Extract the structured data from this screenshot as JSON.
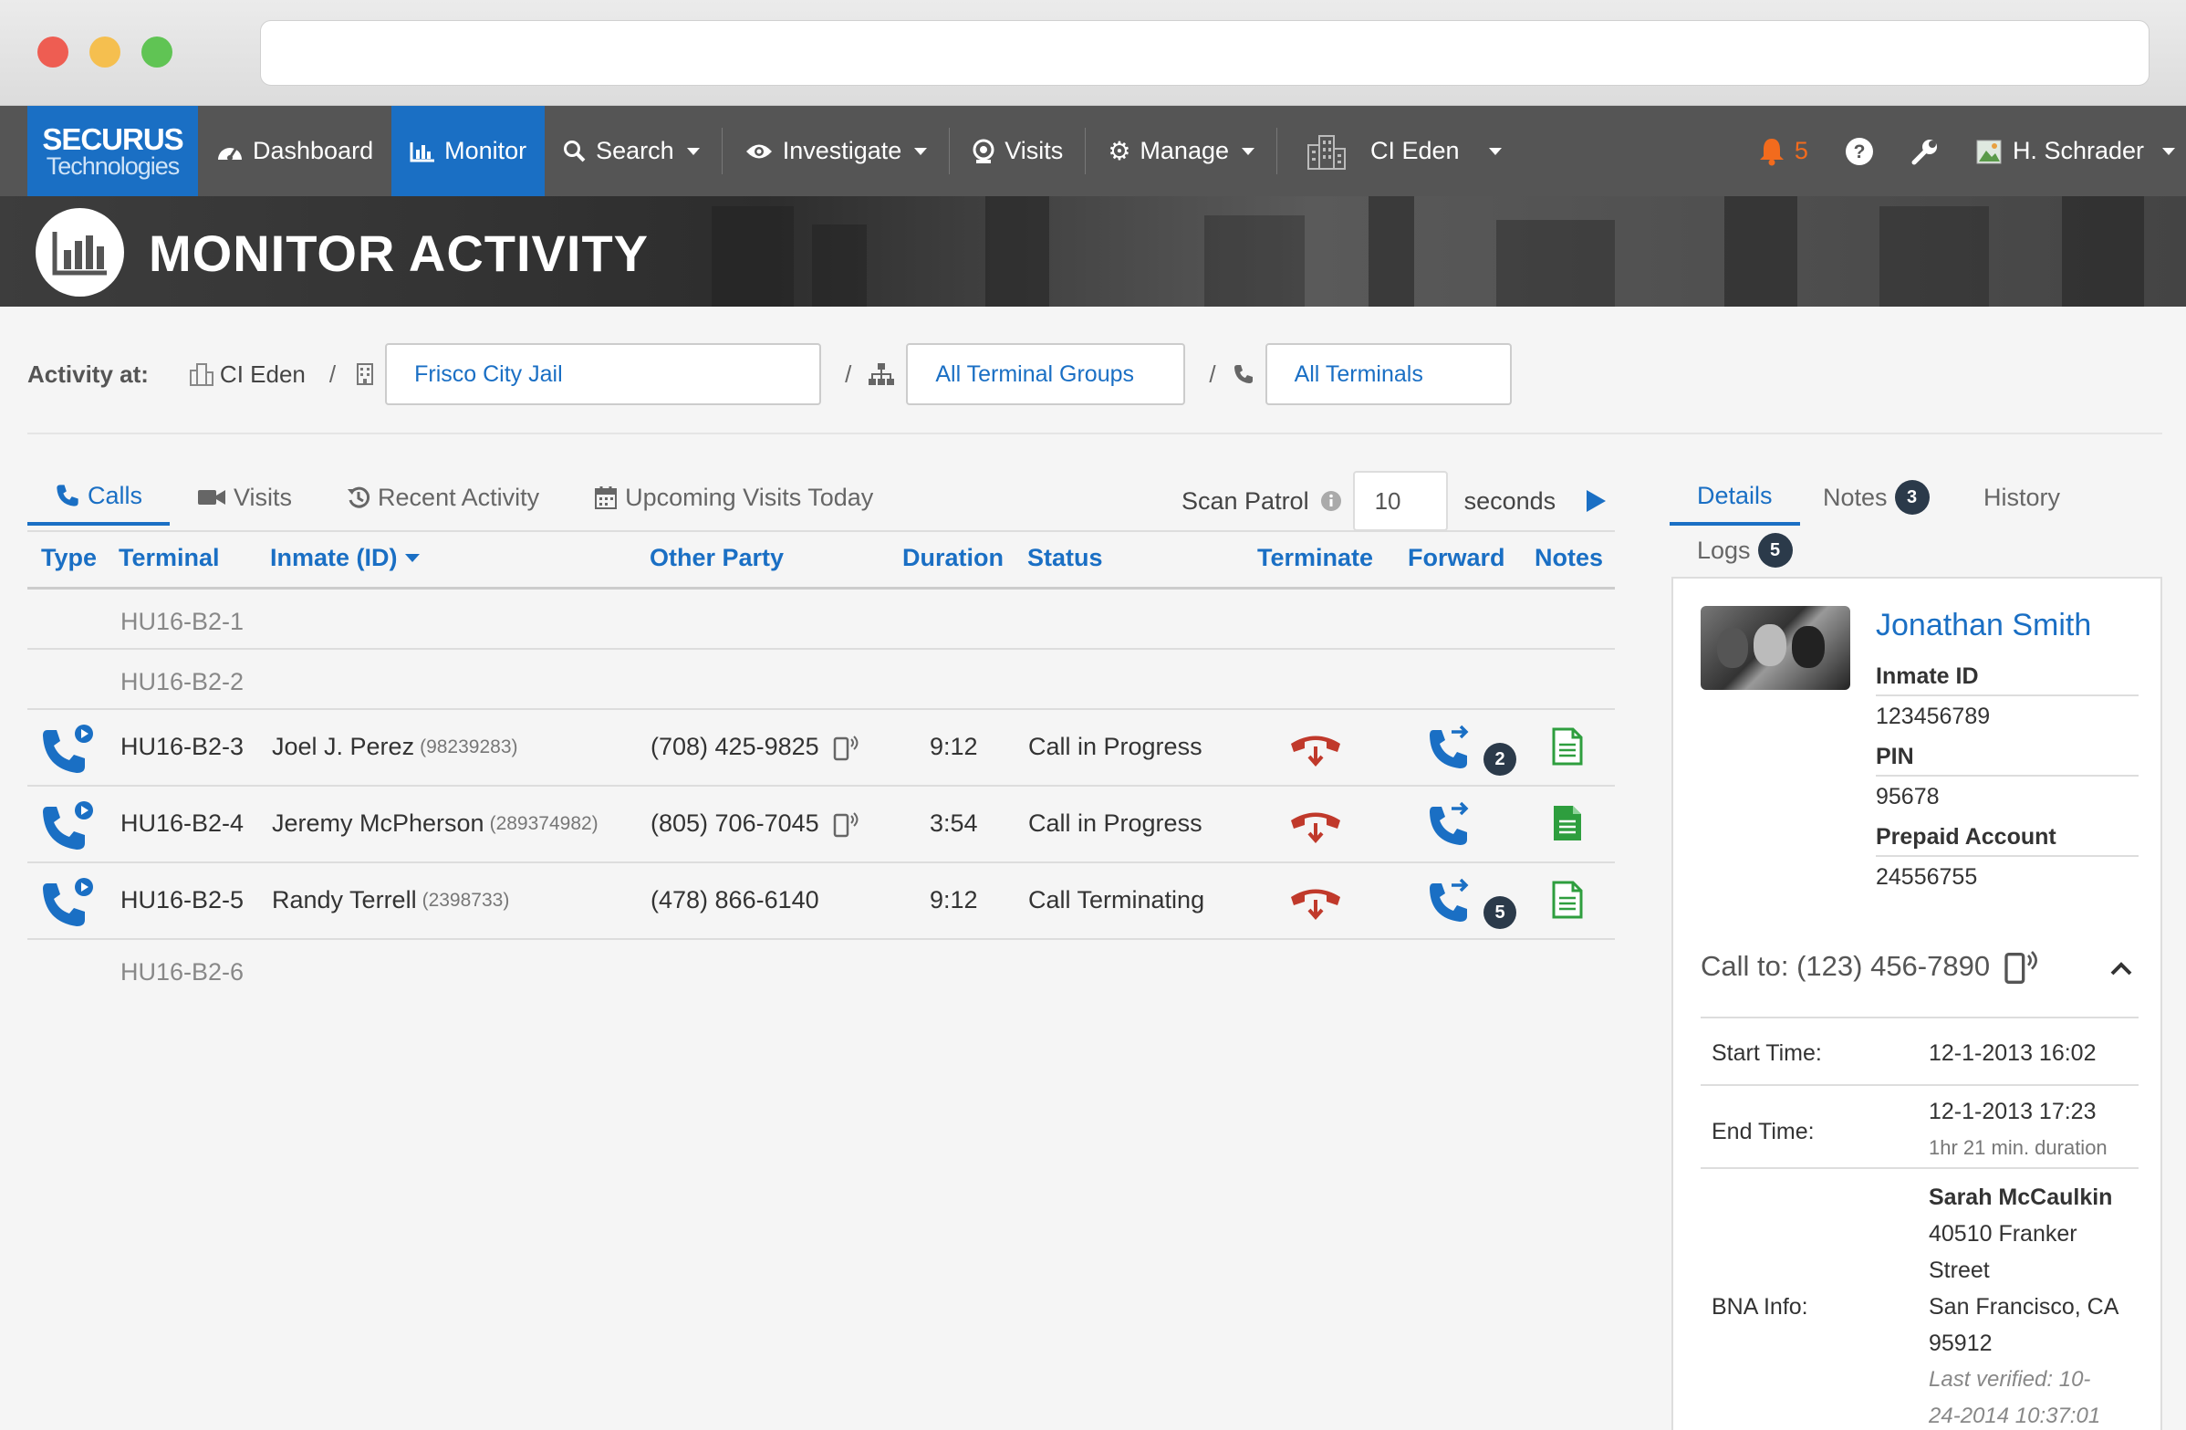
{
  "nav": {
    "logo_line1": "SECURUS",
    "logo_line2": "Technologies",
    "dashboard": "Dashboard",
    "monitor": "Monitor",
    "search": "Search",
    "investigate": "Investigate",
    "visits": "Visits",
    "manage": "Manage",
    "facility": "CI Eden",
    "alert_count": "5",
    "user": "H. Schrader"
  },
  "page": {
    "title": "MONITOR ACTIVITY"
  },
  "activity": {
    "label": "Activity at:",
    "facility": "CI Eden",
    "location": "Frisco City Jail",
    "terminal_groups": "All Terminal Groups",
    "terminals": "All Terminals",
    "slash": "/"
  },
  "tabs": {
    "calls": "Calls",
    "visits": "Visits",
    "recent": "Recent Activity",
    "upcoming": "Upcoming Visits Today"
  },
  "scan": {
    "label": "Scan Patrol",
    "value": "10",
    "unit": "seconds"
  },
  "table": {
    "headers": {
      "type": "Type",
      "terminal": "Terminal",
      "inmate": "Inmate (ID)",
      "other": "Other Party",
      "duration": "Duration",
      "status": "Status",
      "terminate": "Terminate",
      "forward": "Forward",
      "notes": "Notes"
    },
    "rows": [
      {
        "terminal": "HU16-B2-1"
      },
      {
        "terminal": "HU16-B2-2"
      },
      {
        "terminal": "HU16-B2-3",
        "inmate": "Joel J. Perez",
        "id": "(98239283)",
        "other": "(708) 425-9825",
        "duration": "9:12",
        "status": "Call in Progress",
        "forward_count": "2"
      },
      {
        "terminal": "HU16-B2-4",
        "inmate": "Jeremy McPherson",
        "id": "(289374982)",
        "other": "(805) 706-7045",
        "duration": "3:54",
        "status": "Call in Progress"
      },
      {
        "terminal": "HU16-B2-5",
        "inmate": "Randy Terrell",
        "id": "(2398733)",
        "other": "(478) 866-6140",
        "duration": "9:12",
        "status": "Call Terminating",
        "forward_count": "5"
      },
      {
        "terminal": "HU16-B2-6"
      }
    ]
  },
  "right": {
    "tabs": {
      "details": "Details",
      "notes": "Notes",
      "notes_count": "3",
      "history": "History",
      "logs": "Logs",
      "logs_count": "5"
    },
    "name": "Jonathan Smith",
    "inmate_id_label": "Inmate ID",
    "inmate_id": "123456789",
    "pin_label": "PIN",
    "pin": "95678",
    "prepaid_label": "Prepaid Account",
    "prepaid": "24556755",
    "call_to": "Call to: (123) 456-7890",
    "start_label": "Start Time:",
    "start": "12-1-2013 16:02",
    "end_label": "End Time:",
    "end": "12-1-2013 17:23",
    "duration": "1hr 21 min. duration",
    "bna_label": "BNA Info:",
    "bna_name": "Sarah McCaulkin",
    "bna_addr1": "40510 Franker",
    "bna_addr2": "Street",
    "bna_addr3": "San Francisco, CA",
    "bna_addr4": "95912",
    "verified1": "Last verified: 10-",
    "verified2": "24-2014 10:37:01"
  },
  "colors": {
    "accent": "#1a6fc4",
    "danger": "#c0392b",
    "notes_green": "#2e9e3e",
    "alert": "#f26b1d"
  }
}
